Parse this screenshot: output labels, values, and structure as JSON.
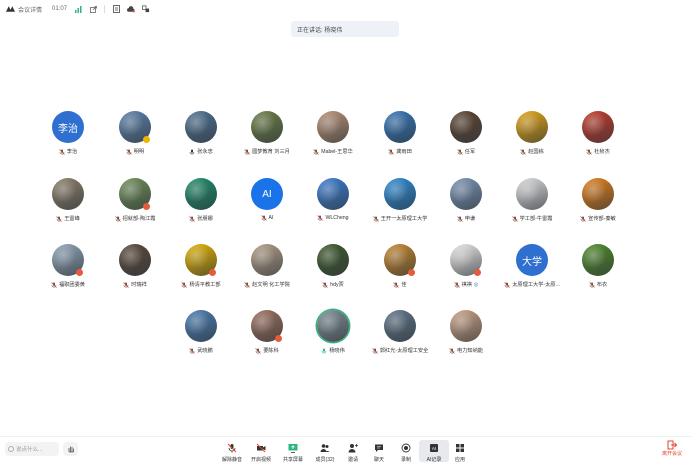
{
  "topbar": {
    "meeting_info": "会议详情",
    "elapsed": "01:07",
    "icons": [
      "logo-icon",
      "signal-icon",
      "share-icon",
      "document-icon",
      "cloud-icon",
      "people-icon"
    ]
  },
  "speaking_banner": "正在讲话: 杨晓伟",
  "participants": [
    {
      "name": "李治",
      "avatar_text": "李治",
      "color": "#2f6fd0",
      "mic": "muted"
    },
    {
      "name": "明明",
      "color": "#5b7fa8",
      "badge": "#f0b400",
      "mic": "muted"
    },
    {
      "name": "张永忠",
      "color": "#4f7092",
      "mic": "on"
    },
    {
      "name": "圆梦教育 刘三月",
      "color": "#6b7d45",
      "mic": "muted"
    },
    {
      "name": "Mabel-王思华",
      "color": "#b78f73",
      "mic": "muted"
    },
    {
      "name": "龚雨田",
      "color": "#3575b8",
      "mic": "muted"
    },
    {
      "name": "任军",
      "color": "#5e4532",
      "mic": "muted"
    },
    {
      "name": "赵国栋",
      "color": "#e0a414",
      "mic": "muted"
    },
    {
      "name": "杜桢杰",
      "color": "#c23a2a",
      "mic": "muted"
    },
    {
      "name": "王雷峰",
      "color": "#8c7e6a",
      "mic": "muted"
    },
    {
      "name": "招就部-陶江霞",
      "color": "#6e8d58",
      "badge": "#e55b3c",
      "mic": "muted"
    },
    {
      "name": "张朋娜",
      "color": "#1e8c6b",
      "mic": "muted"
    },
    {
      "name": "AI",
      "avatar_text": "AI",
      "color": "#1a73e8",
      "mic": "muted"
    },
    {
      "name": "WLCheng",
      "color": "#3a7cd0",
      "mic": "muted"
    },
    {
      "name": "王开一太原理工大学",
      "color": "#2b8ad6",
      "mic": "muted"
    },
    {
      "name": "申谦",
      "color": "#7a93b5",
      "mic": "muted"
    },
    {
      "name": "学工部-牛雷霞",
      "color": "#d9d9d9",
      "mic": "muted"
    },
    {
      "name": "宣传部-秦敏",
      "color": "#e07f1a",
      "mic": "muted"
    },
    {
      "name": "福职团委黄",
      "color": "#8ea2b6",
      "badge": "#e55b3c",
      "mic": "muted"
    },
    {
      "name": "时瑞祥",
      "color": "#5c4a3a",
      "mic": "muted"
    },
    {
      "name": "杨清平教工部",
      "color": "#e1b000",
      "badge": "#e55b3c",
      "mic": "muted"
    },
    {
      "name": "赵文明 化工学院",
      "color": "#b09c84",
      "mic": "muted"
    },
    {
      "name": "hdy贾",
      "color": "#3f5a2c",
      "mic": "muted"
    },
    {
      "name": "佳",
      "color": "#c4862e",
      "badge": "#e55b3c",
      "mic": "muted"
    },
    {
      "name": "祺祺",
      "color": "#e8e4e4",
      "badge": "#e55b3c",
      "mic": "muted",
      "tag": "◎"
    },
    {
      "name": "太原理工大学-太原...",
      "avatar_text": "大学",
      "color": "#2f6fd0",
      "mic": "muted"
    },
    {
      "name": "布衣",
      "color": "#4f8a2a",
      "mic": "muted"
    },
    {
      "name": "武晓鹏",
      "color": "#4a7bb0",
      "mic": "muted"
    },
    {
      "name": "要陈科",
      "color": "#9b6f5c",
      "badge": "#e55b3c",
      "mic": "muted"
    },
    {
      "name": "杨晓伟",
      "color": "#7d8b93",
      "mic": "speaking",
      "active": true
    },
    {
      "name": "郭红光-太原理工安全",
      "color": "#5f7387",
      "mic": "muted"
    },
    {
      "name": "电力知纳能",
      "color": "#c9a184",
      "mic": "muted"
    }
  ],
  "input": {
    "placeholder": "说点什么..."
  },
  "controls": [
    {
      "id": "mute",
      "label": "解除静音"
    },
    {
      "id": "video",
      "label": "开启视频"
    },
    {
      "id": "share",
      "label": "共享屏幕"
    },
    {
      "id": "members",
      "label": "成员(32)"
    },
    {
      "id": "invite",
      "label": "邀请"
    },
    {
      "id": "chat",
      "label": "聊天"
    },
    {
      "id": "record",
      "label": "录制"
    },
    {
      "id": "ai",
      "label": "AI记录"
    },
    {
      "id": "apps",
      "label": "应用"
    }
  ],
  "leave": {
    "label": "离开会议"
  },
  "colors": {
    "accent": "#2f6fd0",
    "leave": "#e0462f",
    "speaking_ring": "#2fb67c"
  }
}
